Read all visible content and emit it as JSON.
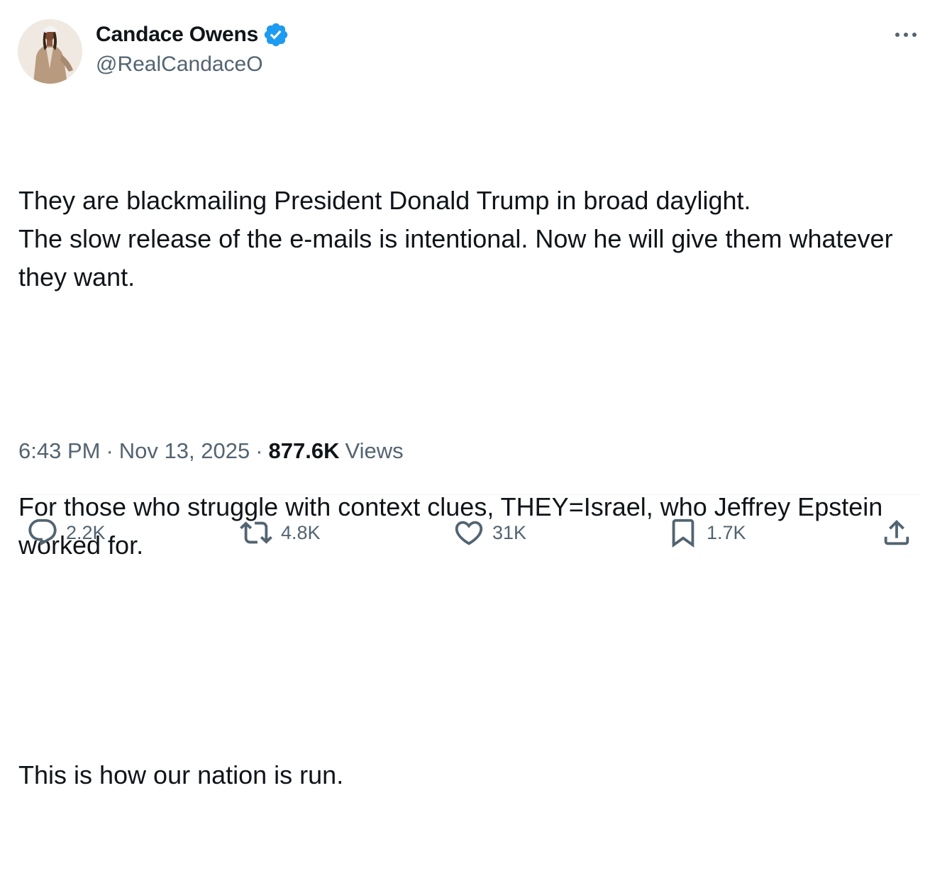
{
  "author": {
    "display_name": "Candace Owens",
    "handle": "@RealCandaceO",
    "verified_color": "#1d9bf0",
    "avatar_icon": "profile-photo",
    "verified_icon": "verified-badge-icon"
  },
  "more_icon": "more-options-icon",
  "post": {
    "paragraphs": [
      "They are blackmailing President Donald Trump in broad daylight.\nThe slow release of the e-mails is intentional. Now he will give them whatever they want.",
      "For those who struggle with context clues, THEY=Israel, who Jeffrey Epstein worked for.",
      "This is how our nation is run."
    ]
  },
  "meta": {
    "time": "6:43 PM",
    "separator": "·",
    "date": "Nov 13, 2025",
    "views_count": "877.6K",
    "views_label": "Views"
  },
  "actions": {
    "reply": {
      "icon": "reply-icon",
      "count": "2.2K"
    },
    "repost": {
      "icon": "repost-icon",
      "count": "4.8K"
    },
    "like": {
      "icon": "heart-icon",
      "count": "31K"
    },
    "bookmark": {
      "icon": "bookmark-icon",
      "count": "1.7K"
    },
    "share": {
      "icon": "share-icon"
    }
  },
  "colors": {
    "text_primary": "#0f1419",
    "text_secondary": "#536471",
    "divider": "#eff3f4"
  }
}
